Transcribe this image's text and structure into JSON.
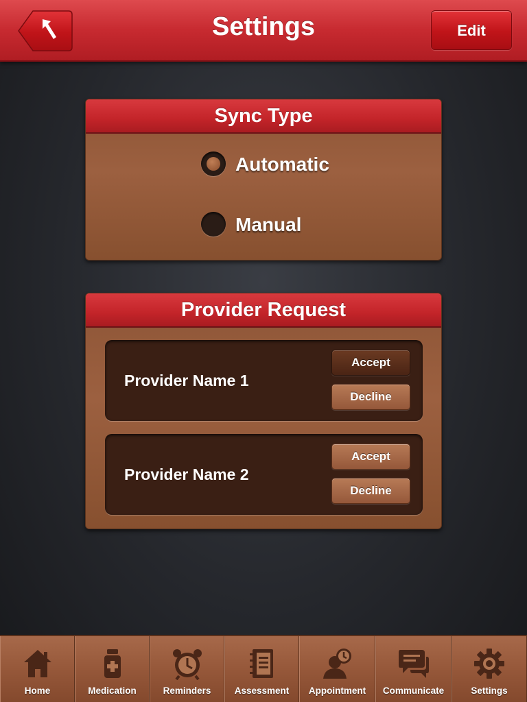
{
  "header": {
    "title": "Settings",
    "edit_label": "Edit"
  },
  "sync_type": {
    "title": "Sync Type",
    "options": [
      {
        "label": "Automatic",
        "selected": true
      },
      {
        "label": "Manual",
        "selected": false
      }
    ]
  },
  "provider_request": {
    "title": "Provider Request",
    "providers": [
      {
        "name": "Provider Name 1",
        "accept_label": "Accept",
        "decline_label": "Decline"
      },
      {
        "name": "Provider Name 2",
        "accept_label": "Accept",
        "decline_label": "Decline"
      }
    ]
  },
  "tabbar": {
    "tabs": [
      {
        "label": "Home",
        "icon": "home-icon"
      },
      {
        "label": "Medication",
        "icon": "medication-icon"
      },
      {
        "label": "Reminders",
        "icon": "alarm-clock-icon"
      },
      {
        "label": "Assessment",
        "icon": "notebook-icon"
      },
      {
        "label": "Appointment",
        "icon": "person-clock-icon"
      },
      {
        "label": "Communicate",
        "icon": "chat-bubbles-icon"
      },
      {
        "label": "Settings",
        "icon": "gear-icon"
      }
    ]
  },
  "colors": {
    "header_red": "#c72a30",
    "panel_brown": "#9c6040",
    "card_dark_brown": "#3a1f14",
    "icon_brown": "#4a2617"
  }
}
